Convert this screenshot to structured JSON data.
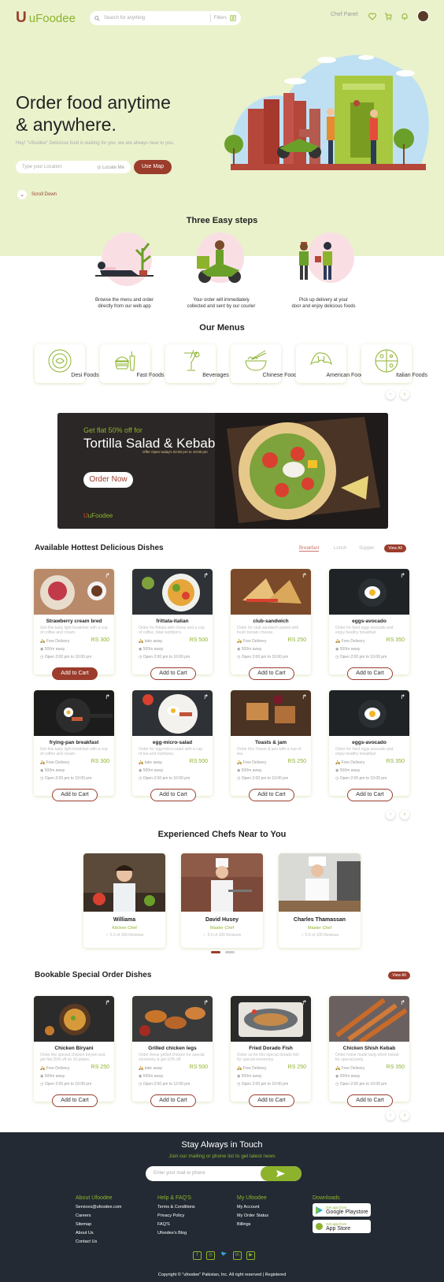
{
  "header": {
    "logo_mark": "U",
    "logo_text": "uFoodee",
    "search_placeholder": "Search for anything",
    "filters_label": "Filters",
    "chef_panel": "Chef Panel",
    "icons": [
      "heart-icon",
      "cart-icon",
      "bell-icon",
      "avatar"
    ]
  },
  "hero": {
    "title_line1": "Order food anytime",
    "title_line2": "& anywhere.",
    "subtitle": "Hey! \"Ufoodee\" Delicious food is waiting for you, we are always near to you.",
    "location_placeholder": "Type your Location",
    "locate_me": "Locate Me",
    "use_map": "Use Map",
    "scroll_down": "Scroll Down"
  },
  "steps": {
    "title": "Three Easy steps",
    "items": [
      {
        "line1": "Browse the menu and order",
        "line2": "directly from  our web app"
      },
      {
        "line1": "Your order will immediately",
        "line2": "collected and sent by our courier"
      },
      {
        "line1": "Pick up delivery at your",
        "line2": "door and enjoy delicious foods"
      }
    ]
  },
  "menus": {
    "title": "Our Menus",
    "items": [
      "Desi Foods",
      "Fast Foods",
      "Beverages",
      "Chinese Foods",
      "American Foods",
      "Italian Foods"
    ]
  },
  "banner": {
    "offer": "Get flat 50% off for",
    "title": "Tortilla Salad & Kebab",
    "timing": "Offer Open today's 02:00 pm to 10:00 pm",
    "cta": "Order Now",
    "brand": "uFoodee"
  },
  "hottest": {
    "title": "Available Hottest Delicious Dishes",
    "tabs": [
      "Breakfast",
      "Lunch",
      "Supper"
    ],
    "view_all": "View All",
    "add_label": "Add to Cart",
    "distance": "500m away",
    "open": "Open 2:00 pm to 10:00 pm",
    "dishes": [
      {
        "name": "Strawberry cream bred",
        "desc": "Get this tasty light breakfast with a cup of coffee and cream.",
        "delivery": "Free Delivery",
        "price": "RS 300"
      },
      {
        "name": "frittata-italian",
        "desc": "Order for frittata with chees and a cup of coffee, total nutrition's.",
        "delivery": "take away",
        "price": "RS 500"
      },
      {
        "name": "club-sandwich",
        "desc": "Order for club sandwich paired with fresh tomato cheese.",
        "delivery": "Free Delivery",
        "price": "RS 250"
      },
      {
        "name": "eggs-avocado",
        "desc": "Order for fried eggs avocado and enjoy healthy breakfast.",
        "delivery": "Free Delivery",
        "price": "RS 350"
      },
      {
        "name": "frying-pan breakfast",
        "desc": "Get this tasty light breakfast with a cup of coffee and cream.",
        "delivery": "Free Delivery",
        "price": "RS 300"
      },
      {
        "name": "egg-micro-salad",
        "desc": "Order for egg-micro-salad with a cup of tea and nutritions.",
        "delivery": "take away",
        "price": "RS 500"
      },
      {
        "name": "Toasts & jam",
        "desc": "Order this Toasts & jam with a cup of tea.",
        "delivery": "Free Delivery",
        "price": "RS 250"
      },
      {
        "name": "eggs-avocado",
        "desc": "Order for fried eggs avocado and enjoy healthy breakfast.",
        "delivery": "Free Delivery",
        "price": "RS 350"
      }
    ]
  },
  "chefs": {
    "title": "Experienced Chefs Near to You",
    "items": [
      {
        "name": "Williama",
        "role": "Kitchen Chef",
        "reviews": "5.0 of 100 Reviews"
      },
      {
        "name": "David Husey",
        "role": "Master Chef",
        "reviews": "5.0 of 100 Reviews"
      },
      {
        "name": "Charles Thamassan",
        "role": "Master Chef",
        "reviews": "5.0 of 100 Reviews"
      }
    ]
  },
  "special": {
    "title": "Bookable Special Order Dishes",
    "view_all": "View All",
    "add_label": "Add to Cart",
    "distance": "500m away",
    "dishes": [
      {
        "name": "Chicken Biryani",
        "desc": "Order the special chicken biryani and get flat 25% off on 10 plates.",
        "delivery": "Free Delivery",
        "price": "RS 250",
        "open": "Open 2:00 pm to 10:00 pm"
      },
      {
        "name": "Grilled chicken legs",
        "desc": "Order these grilled chicken for special ceremony & get 10% off.",
        "delivery": "take away",
        "price": "RS 500",
        "open": "Open 2:00 pm to 12:00 pm"
      },
      {
        "name": "Fried Dorado Fish",
        "desc": "Order us for this special dorado fish for special ceremony.",
        "delivery": "Free Delivery",
        "price": "RS 250",
        "open": "Open 2:00 pm to 10:00 pm"
      },
      {
        "name": "Chicken Shish Kebab",
        "desc": "Order home made tasty shish kebab for special party.",
        "delivery": "Free Delivery",
        "price": "RS 350",
        "open": "Open 2:00 pm to 10:00 pm"
      }
    ]
  },
  "footer": {
    "title": "Stay Always in Touch",
    "subtitle": "Join our mailing or phone list to get latest news",
    "email_placeholder": "Enter your mail or phone",
    "cols": [
      {
        "head": "About Ufoodee",
        "links": [
          "Services@ufoodee.com",
          "Careers",
          "Sitemap",
          "About Us",
          "Contact Us"
        ]
      },
      {
        "head": "Help & FAQ'S",
        "links": [
          "Terms & Conditions",
          "Privacy Policy",
          "FAQ'S",
          "Ufoodee's Blog"
        ]
      },
      {
        "head": "My Ufoodee",
        "links": [
          "My Account",
          "My Order Status",
          "Billings"
        ]
      }
    ],
    "downloads": "Downloads",
    "playstore_small": "Get app from",
    "playstore": "Google Playstore",
    "appstore_small": "Get app from",
    "appstore": "App Store",
    "social": [
      "facebook-icon",
      "instagram-icon",
      "twitter-icon",
      "linkedin-icon",
      "youtube-icon"
    ],
    "copyright": "Copyright © \"ufoodee\" Pakistan, Inc. All right reserved | Registered"
  },
  "colors": {
    "brand_red": "#9b3c2c",
    "brand_green": "#8db32d",
    "hero_bg": "#eaf2cc",
    "footer_bg": "#232a33"
  }
}
